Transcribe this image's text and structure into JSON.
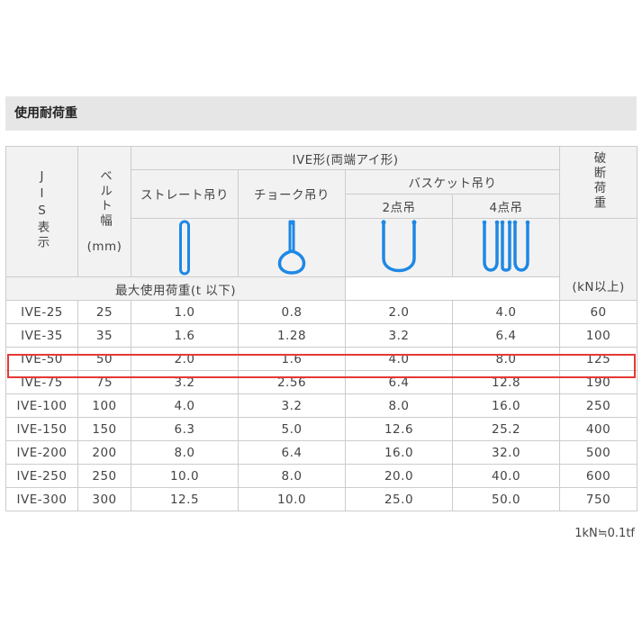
{
  "section_title": "使用耐荷重",
  "header": {
    "jis": "JIS表示",
    "belt_width": "ベルト幅",
    "belt_unit": "(mm)",
    "group": "IVE形(両端アイ形)",
    "straight": "ストレート吊り",
    "choke": "チョーク吊り",
    "basket": "バスケット吊り",
    "basket2": "2点吊",
    "basket4": "4点吊",
    "breaking": "破断荷重",
    "breaking_unit": "(kN以上)",
    "max_load": "最大使用荷重(t 以下)"
  },
  "rows": [
    [
      "IVE-25",
      "25",
      "1.0",
      "0.8",
      "2.0",
      "4.0",
      "60"
    ],
    [
      "IVE-35",
      "35",
      "1.6",
      "1.28",
      "3.2",
      "6.4",
      "100"
    ],
    [
      "IVE-50",
      "50",
      "2.0",
      "1.6",
      "4.0",
      "8.0",
      "125"
    ],
    [
      "IVE-75",
      "75",
      "3.2",
      "2.56",
      "6.4",
      "12.8",
      "190"
    ],
    [
      "IVE-100",
      "100",
      "4.0",
      "3.2",
      "8.0",
      "16.0",
      "250"
    ],
    [
      "IVE-150",
      "150",
      "6.3",
      "5.0",
      "12.6",
      "25.2",
      "400"
    ],
    [
      "IVE-200",
      "200",
      "8.0",
      "6.4",
      "16.0",
      "32.0",
      "500"
    ],
    [
      "IVE-250",
      "250",
      "10.0",
      "8.0",
      "20.0",
      "40.0",
      "600"
    ],
    [
      "IVE-300",
      "300",
      "12.5",
      "10.0",
      "25.0",
      "50.0",
      "750"
    ]
  ],
  "highlighted_row": "IVE-50",
  "note": "1kN≒0.1tf",
  "colors": {
    "sling": "#1e88e5",
    "highlight": "#e53935"
  }
}
